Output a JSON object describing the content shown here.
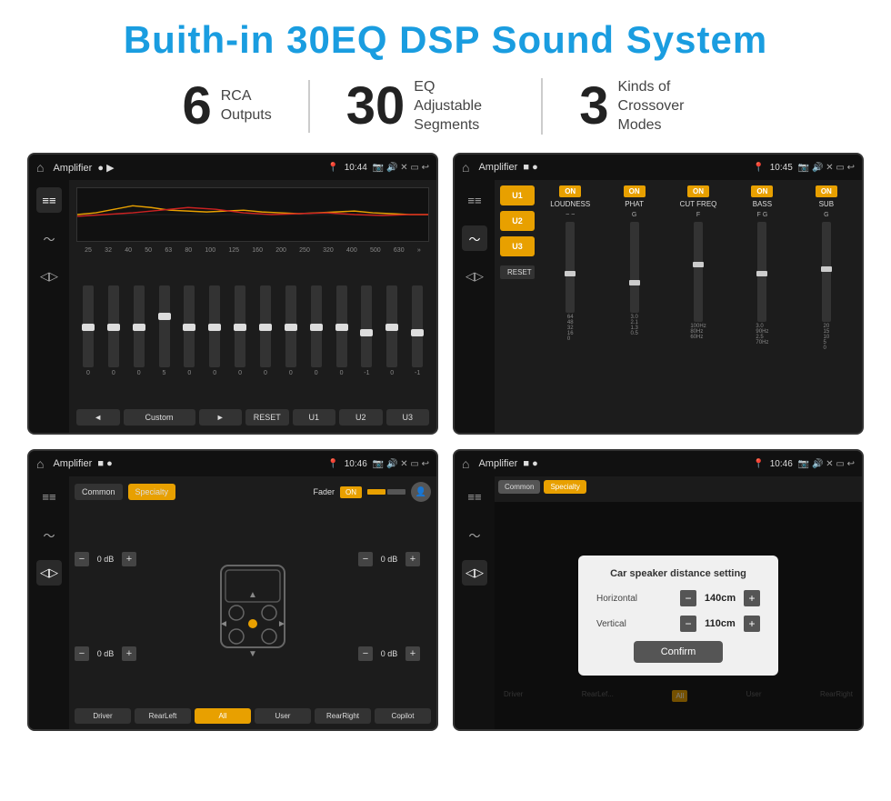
{
  "page": {
    "title": "Buith-in 30EQ DSP Sound System",
    "background": "#ffffff"
  },
  "stats": [
    {
      "number": "6",
      "label": "RCA\nOutputs"
    },
    {
      "number": "30",
      "label": "EQ Adjustable\nSegments"
    },
    {
      "number": "3",
      "label": "Kinds of\nCrossover Modes"
    }
  ],
  "screens": [
    {
      "id": "eq-screen",
      "statusBar": {
        "title": "Amplifier",
        "time": "10:44"
      },
      "type": "eq"
    },
    {
      "id": "crossover-screen",
      "statusBar": {
        "title": "Amplifier",
        "time": "10:45"
      },
      "type": "crossover"
    },
    {
      "id": "fader-screen",
      "statusBar": {
        "title": "Amplifier",
        "time": "10:46"
      },
      "type": "fader"
    },
    {
      "id": "distance-screen",
      "statusBar": {
        "title": "Amplifier",
        "time": "10:46"
      },
      "type": "distance-dialog"
    }
  ],
  "eq": {
    "frequencies": [
      "25",
      "32",
      "40",
      "50",
      "63",
      "80",
      "100",
      "125",
      "160",
      "200",
      "250",
      "320",
      "400",
      "500",
      "630"
    ],
    "values": [
      "0",
      "0",
      "0",
      "5",
      "0",
      "0",
      "0",
      "0",
      "0",
      "0",
      "0",
      "-1",
      "0",
      "-1"
    ],
    "sliderPositions": [
      50,
      50,
      50,
      35,
      50,
      50,
      50,
      50,
      50,
      50,
      50,
      60,
      50,
      60
    ],
    "bottomButtons": [
      "◄",
      "Custom",
      "►",
      "RESET",
      "U1",
      "U2",
      "U3"
    ]
  },
  "crossover": {
    "uButtons": [
      "U1",
      "U2",
      "U3"
    ],
    "channels": [
      {
        "label": "LOUDNESS",
        "on": true
      },
      {
        "label": "PHAT",
        "on": true
      },
      {
        "label": "CUT FREQ",
        "on": true
      },
      {
        "label": "BASS",
        "on": true
      },
      {
        "label": "SUB",
        "on": true
      }
    ],
    "resetLabel": "RESET"
  },
  "fader": {
    "tabs": [
      "Common",
      "Specialty"
    ],
    "activeTab": "Specialty",
    "faderLabel": "Fader",
    "faderOnLabel": "ON",
    "dbValues": [
      "0 dB",
      "0 dB",
      "0 dB",
      "0 dB"
    ],
    "bottomButtons": [
      "Driver",
      "RearLeft",
      "All",
      "User",
      "RearRight",
      "Copilot"
    ]
  },
  "dialog": {
    "title": "Car speaker distance setting",
    "horizontalLabel": "Horizontal",
    "horizontalValue": "140cm",
    "verticalLabel": "Vertical",
    "verticalValue": "110cm",
    "confirmLabel": "Confirm"
  }
}
